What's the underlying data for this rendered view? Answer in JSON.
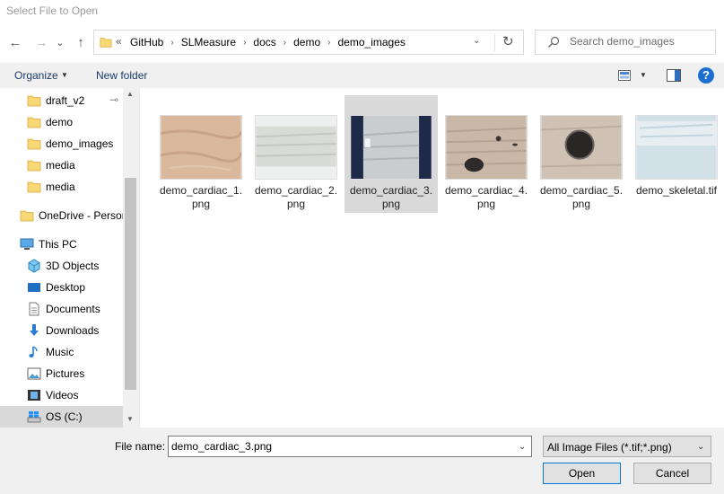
{
  "window": {
    "title": "Select File to Open"
  },
  "nav": {
    "back_glyph": "←",
    "forward_glyph": "→",
    "recent_glyph": "⌄",
    "up_glyph": "↑",
    "overflow_glyph": "«",
    "breadcrumbs": [
      "GitHub",
      "SLMeasure",
      "docs",
      "demo",
      "demo_images"
    ],
    "crumb_sep": "›",
    "address_dropdown_glyph": "⌄",
    "refresh_glyph": "↻"
  },
  "search": {
    "placeholder": "Search demo_images"
  },
  "toolbar": {
    "organize_label": "Organize",
    "new_folder_label": "New folder",
    "help_glyph": "?"
  },
  "sidebar": {
    "items": [
      {
        "label": "draft_v2",
        "icon": "folder-icon",
        "pinned": true
      },
      {
        "label": "demo",
        "icon": "folder-icon"
      },
      {
        "label": "demo_images",
        "icon": "folder-icon"
      },
      {
        "label": "media",
        "icon": "folder-icon"
      },
      {
        "label": "media",
        "icon": "folder-icon"
      },
      {
        "label": "OneDrive - Persor",
        "icon": "folder-icon"
      },
      {
        "label": "This PC",
        "icon": "computer-icon"
      },
      {
        "label": "3D Objects",
        "icon": "cube-icon"
      },
      {
        "label": "Desktop",
        "icon": "desktop-icon"
      },
      {
        "label": "Documents",
        "icon": "documents-icon"
      },
      {
        "label": "Downloads",
        "icon": "download-icon"
      },
      {
        "label": "Music",
        "icon": "music-icon"
      },
      {
        "label": "Pictures",
        "icon": "pictures-icon"
      },
      {
        "label": "Videos",
        "icon": "videos-icon"
      },
      {
        "label": "OS (C:)",
        "icon": "drive-icon",
        "selected": true
      }
    ],
    "pin_glyph": "📌"
  },
  "files": [
    {
      "name": "demo_cardiac_1.png",
      "line1": "demo_cardiac_1.",
      "line2": "png",
      "selected": false
    },
    {
      "name": "demo_cardiac_2.png",
      "line1": "demo_cardiac_2.",
      "line2": "png",
      "selected": false
    },
    {
      "name": "demo_cardiac_3.png",
      "line1": "demo_cardiac_3.",
      "line2": "png",
      "selected": true
    },
    {
      "name": "demo_cardiac_4.png",
      "line1": "demo_cardiac_4.",
      "line2": "png",
      "selected": false
    },
    {
      "name": "demo_cardiac_5.png",
      "line1": "demo_cardiac_5.",
      "line2": "png",
      "selected": false
    },
    {
      "name": "demo_skeletal.tif",
      "line1": "demo_skeletal.tif",
      "line2": "",
      "selected": false
    }
  ],
  "bottom": {
    "file_name_label": "File name:",
    "file_name_value": "demo_cardiac_3.png",
    "file_type_value": "All Image Files (*.tif;*.png)",
    "open_label": "Open",
    "cancel_label": "Cancel"
  },
  "colors": {
    "accent": "#0078d7",
    "folder": "#f8d775",
    "selection": "#d9d9d9",
    "help": "#1c6fd0"
  }
}
